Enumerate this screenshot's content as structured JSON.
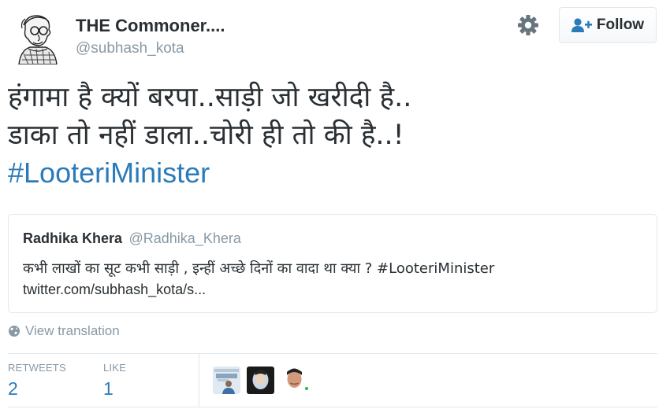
{
  "author": {
    "name": "THE Commoner....",
    "handle": "@subhash_kota"
  },
  "actions": {
    "follow_label": "Follow"
  },
  "tweet": {
    "lines": [
      "हंगामा है क्यों बरपा..साड़ी जो खरीदी है..",
      "डाका तो नहीं डाला..चोरी ही तो की है..!"
    ],
    "hashtag": "#LooteriMinister"
  },
  "quoted_tweet": {
    "name": "Radhika Khera",
    "handle": "@Radhika_Khera",
    "text": "कभी लाखों का सूट कभी साड़ी , इन्हीं अच्छे दिनों का वादा था क्या ? #LooteriMinister",
    "link": "twitter.com/subhash_kota/s..."
  },
  "view_translation": "View translation",
  "stats": {
    "retweets_label": "RETWEETS",
    "retweets_count": "2",
    "likes_label": "LIKE",
    "likes_count": "1"
  },
  "colors": {
    "link": "#2b7bb9",
    "muted": "#8899a6",
    "text": "#292f33",
    "border": "#e1e8ed"
  },
  "icons": {
    "settings": "gear-icon",
    "follow": "add-user-icon",
    "translate": "globe-icon"
  }
}
